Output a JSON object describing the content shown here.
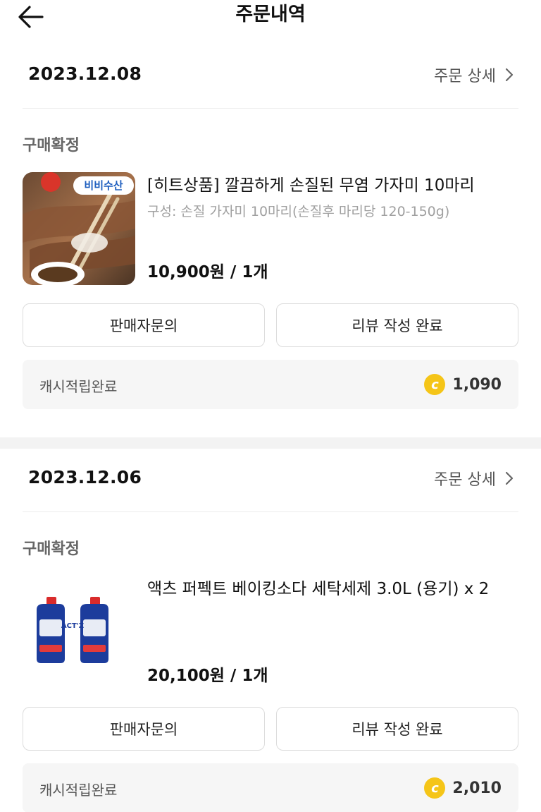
{
  "header": {
    "title": "주문내역",
    "back_icon": "arrow-left-icon"
  },
  "orders": [
    {
      "date": "2023.12.08",
      "detail_label": "주문 상세",
      "status": "구매확정",
      "product": {
        "thumb_badge": "비비수산",
        "name": "[히트상품] 깔끔하게 손질된 무염 가자미 10마리",
        "option": "구성: 손질 가자미 10마리(손질후 마리당 120-150g)",
        "price": "10,900원 / 1개"
      },
      "buttons": {
        "inquiry": "판매자문의",
        "review": "리뷰 작성 완료"
      },
      "cash": {
        "label": "캐시적립완료",
        "amount": "1,090",
        "coin_symbol": "c"
      }
    },
    {
      "date": "2023.12.06",
      "detail_label": "주문 상세",
      "status": "구매확정",
      "product": {
        "thumb_badge": "ACT'Z",
        "name": "액츠 퍼펙트 베이킹소다 세탁세제 3.0L (용기) x 2",
        "option": "",
        "price": "20,100원 / 1개"
      },
      "buttons": {
        "inquiry": "판매자문의",
        "review": "리뷰 작성 완료"
      },
      "cash": {
        "label": "캐시적립완료",
        "amount": "2,010",
        "coin_symbol": "c"
      }
    }
  ],
  "colors": {
    "coin": "#f5c518",
    "muted": "#a0a0a0",
    "panel": "#f6f6f6"
  }
}
